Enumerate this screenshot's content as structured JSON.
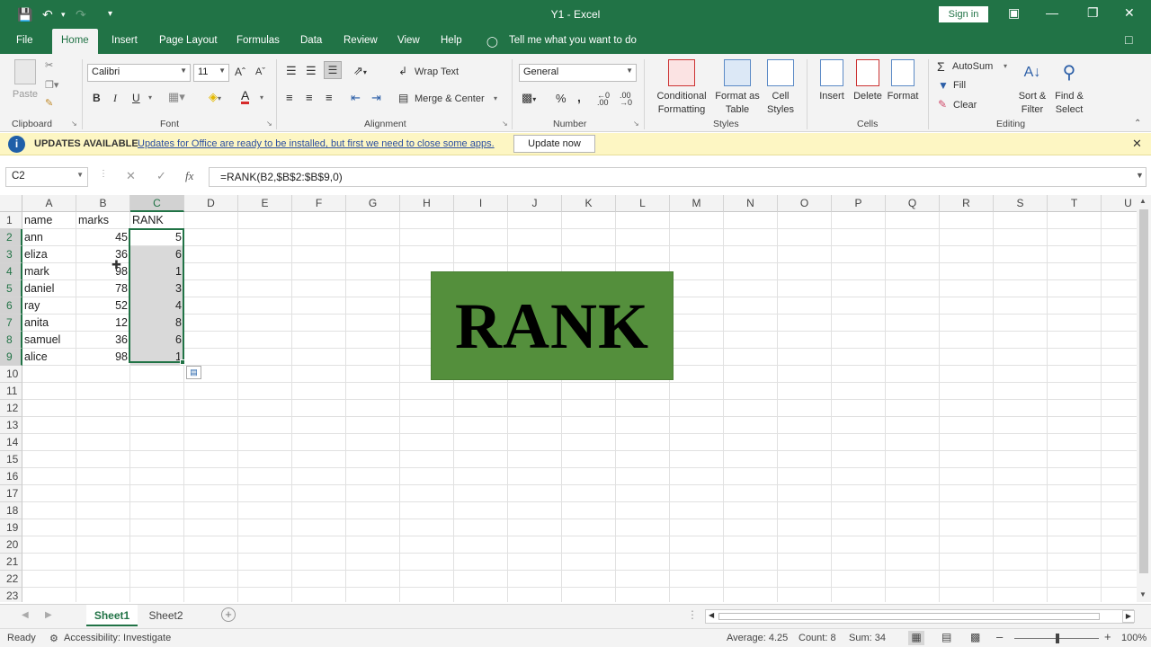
{
  "window": {
    "title": "Y1  -  Excel",
    "sign_in": "Sign in"
  },
  "ribbon_tabs": [
    "File",
    "Home",
    "Insert",
    "Page Layout",
    "Formulas",
    "Data",
    "Review",
    "View",
    "Help"
  ],
  "tell_me": "Tell me what you want to do",
  "clipboard": {
    "paste": "Paste",
    "label": "Clipboard"
  },
  "font": {
    "name": "Calibri",
    "size": "11",
    "bold": "B",
    "italic": "I",
    "underline": "U",
    "label": "Font"
  },
  "alignment": {
    "wrap_text": "Wrap Text",
    "merge_center": "Merge & Center",
    "label": "Alignment"
  },
  "number": {
    "format": "General",
    "percent": "%",
    "comma": ",",
    "label": "Number"
  },
  "styles": {
    "conditional": "Conditional Formatting",
    "format_table": "Format as Table",
    "cell_styles": "Cell Styles",
    "label": "Styles"
  },
  "cells": {
    "insert": "Insert",
    "delete": "Delete",
    "format": "Format",
    "label": "Cells"
  },
  "editing": {
    "autosum": "AutoSum",
    "fill": "Fill",
    "clear": "Clear",
    "sort": "Sort & Filter",
    "find": "Find & Select",
    "label": "Editing"
  },
  "infobar": {
    "title": "UPDATES AVAILABLE",
    "message": "Updates for Office are ready to be installed, but first we need to close some apps.",
    "button": "Update now"
  },
  "formula_bar": {
    "name_box": "C2",
    "formula": "=RANK(B2,$B$2:$B$9,0)",
    "fx": "fx"
  },
  "columns": [
    "A",
    "B",
    "C",
    "D",
    "E",
    "F",
    "G",
    "H",
    "I",
    "J",
    "K",
    "L",
    "M",
    "N",
    "O",
    "P",
    "Q",
    "R",
    "S",
    "T",
    "U"
  ],
  "rows": [
    "1",
    "2",
    "3",
    "4",
    "5",
    "6",
    "7",
    "8",
    "9",
    "10",
    "11",
    "12",
    "13",
    "14",
    "15",
    "16",
    "17",
    "18",
    "19",
    "20",
    "21",
    "22",
    "23"
  ],
  "sheet": {
    "headers": [
      "name",
      "marks",
      "RANK"
    ],
    "data": [
      [
        "ann",
        "45",
        "5"
      ],
      [
        "eliza",
        "36",
        "6"
      ],
      [
        "mark",
        "98",
        "1"
      ],
      [
        "daniel",
        "78",
        "3"
      ],
      [
        "ray",
        "52",
        "4"
      ],
      [
        "anita",
        "12",
        "8"
      ],
      [
        "samuel",
        "36",
        "6"
      ],
      [
        "alice",
        "98",
        "1"
      ]
    ]
  },
  "overlay_text": "RANK",
  "sheet_tabs": [
    "Sheet1",
    "Sheet2"
  ],
  "status": {
    "ready": "Ready",
    "accessibility": "Accessibility: Investigate",
    "average": "Average: 4.25",
    "count": "Count: 8",
    "sum": "Sum: 34",
    "zoom": "100%"
  },
  "colors": {
    "excel_green": "#217346",
    "overlay_green": "#548f3c",
    "info_yellow": "#fdf6c3"
  }
}
